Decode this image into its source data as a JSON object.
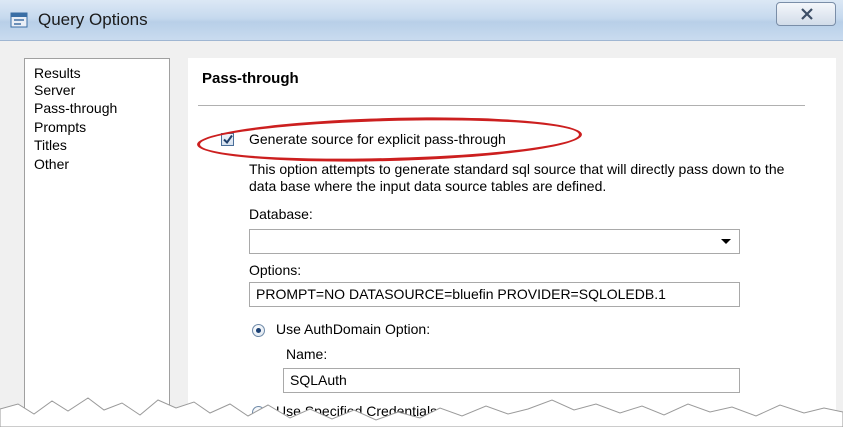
{
  "window": {
    "title": "Query Options",
    "close_symbol": "✕"
  },
  "nav": {
    "items": [
      {
        "label": "Results"
      },
      {
        "label": "Server"
      },
      {
        "label": "Pass-through"
      },
      {
        "label": "Prompts"
      },
      {
        "label": "Titles"
      },
      {
        "label": "Other"
      }
    ]
  },
  "panel": {
    "section_title": "Pass-through",
    "checkbox": {
      "label": "Generate source for explicit pass-through",
      "checked": true
    },
    "description": "This option attempts to generate standard sql source that will directly pass down to the data base where the input data source tables are defined.",
    "database": {
      "label": "Database:",
      "value": ""
    },
    "options": {
      "label": "Options:",
      "value": "PROMPT=NO DATASOURCE=bluefin PROVIDER=SQLOLEDB.1"
    },
    "auth_domain": {
      "label": "Use AuthDomain Option:",
      "selected": true
    },
    "name": {
      "label": "Name:",
      "value": "SQLAuth"
    },
    "specified_credentials": {
      "label": "Use Specified Credentials",
      "selected": false
    }
  },
  "colors": {
    "highlight_oval": "#cc1f1f",
    "titlebar": "#c6d9ee"
  }
}
